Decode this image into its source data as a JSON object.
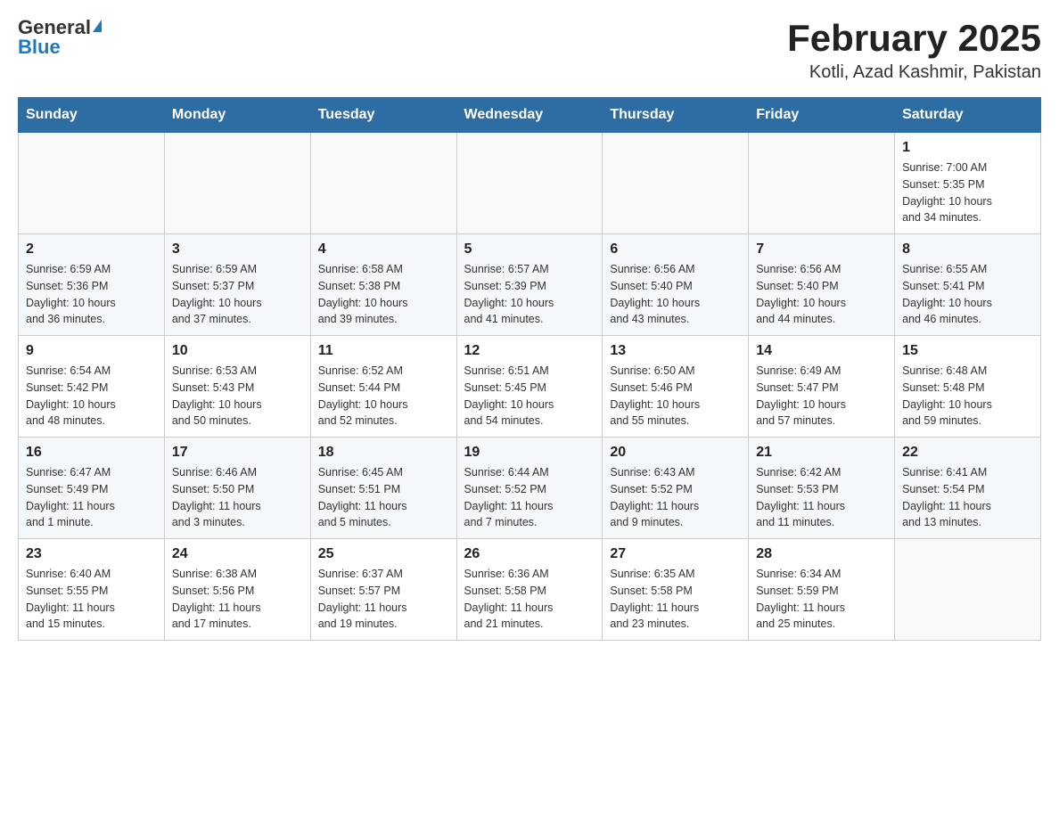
{
  "header": {
    "logo_general": "General",
    "logo_blue": "Blue",
    "month_title": "February 2025",
    "location": "Kotli, Azad Kashmir, Pakistan"
  },
  "weekdays": [
    "Sunday",
    "Monday",
    "Tuesday",
    "Wednesday",
    "Thursday",
    "Friday",
    "Saturday"
  ],
  "weeks": [
    [
      {
        "day": "",
        "info": ""
      },
      {
        "day": "",
        "info": ""
      },
      {
        "day": "",
        "info": ""
      },
      {
        "day": "",
        "info": ""
      },
      {
        "day": "",
        "info": ""
      },
      {
        "day": "",
        "info": ""
      },
      {
        "day": "1",
        "info": "Sunrise: 7:00 AM\nSunset: 5:35 PM\nDaylight: 10 hours\nand 34 minutes."
      }
    ],
    [
      {
        "day": "2",
        "info": "Sunrise: 6:59 AM\nSunset: 5:36 PM\nDaylight: 10 hours\nand 36 minutes."
      },
      {
        "day": "3",
        "info": "Sunrise: 6:59 AM\nSunset: 5:37 PM\nDaylight: 10 hours\nand 37 minutes."
      },
      {
        "day": "4",
        "info": "Sunrise: 6:58 AM\nSunset: 5:38 PM\nDaylight: 10 hours\nand 39 minutes."
      },
      {
        "day": "5",
        "info": "Sunrise: 6:57 AM\nSunset: 5:39 PM\nDaylight: 10 hours\nand 41 minutes."
      },
      {
        "day": "6",
        "info": "Sunrise: 6:56 AM\nSunset: 5:40 PM\nDaylight: 10 hours\nand 43 minutes."
      },
      {
        "day": "7",
        "info": "Sunrise: 6:56 AM\nSunset: 5:40 PM\nDaylight: 10 hours\nand 44 minutes."
      },
      {
        "day": "8",
        "info": "Sunrise: 6:55 AM\nSunset: 5:41 PM\nDaylight: 10 hours\nand 46 minutes."
      }
    ],
    [
      {
        "day": "9",
        "info": "Sunrise: 6:54 AM\nSunset: 5:42 PM\nDaylight: 10 hours\nand 48 minutes."
      },
      {
        "day": "10",
        "info": "Sunrise: 6:53 AM\nSunset: 5:43 PM\nDaylight: 10 hours\nand 50 minutes."
      },
      {
        "day": "11",
        "info": "Sunrise: 6:52 AM\nSunset: 5:44 PM\nDaylight: 10 hours\nand 52 minutes."
      },
      {
        "day": "12",
        "info": "Sunrise: 6:51 AM\nSunset: 5:45 PM\nDaylight: 10 hours\nand 54 minutes."
      },
      {
        "day": "13",
        "info": "Sunrise: 6:50 AM\nSunset: 5:46 PM\nDaylight: 10 hours\nand 55 minutes."
      },
      {
        "day": "14",
        "info": "Sunrise: 6:49 AM\nSunset: 5:47 PM\nDaylight: 10 hours\nand 57 minutes."
      },
      {
        "day": "15",
        "info": "Sunrise: 6:48 AM\nSunset: 5:48 PM\nDaylight: 10 hours\nand 59 minutes."
      }
    ],
    [
      {
        "day": "16",
        "info": "Sunrise: 6:47 AM\nSunset: 5:49 PM\nDaylight: 11 hours\nand 1 minute."
      },
      {
        "day": "17",
        "info": "Sunrise: 6:46 AM\nSunset: 5:50 PM\nDaylight: 11 hours\nand 3 minutes."
      },
      {
        "day": "18",
        "info": "Sunrise: 6:45 AM\nSunset: 5:51 PM\nDaylight: 11 hours\nand 5 minutes."
      },
      {
        "day": "19",
        "info": "Sunrise: 6:44 AM\nSunset: 5:52 PM\nDaylight: 11 hours\nand 7 minutes."
      },
      {
        "day": "20",
        "info": "Sunrise: 6:43 AM\nSunset: 5:52 PM\nDaylight: 11 hours\nand 9 minutes."
      },
      {
        "day": "21",
        "info": "Sunrise: 6:42 AM\nSunset: 5:53 PM\nDaylight: 11 hours\nand 11 minutes."
      },
      {
        "day": "22",
        "info": "Sunrise: 6:41 AM\nSunset: 5:54 PM\nDaylight: 11 hours\nand 13 minutes."
      }
    ],
    [
      {
        "day": "23",
        "info": "Sunrise: 6:40 AM\nSunset: 5:55 PM\nDaylight: 11 hours\nand 15 minutes."
      },
      {
        "day": "24",
        "info": "Sunrise: 6:38 AM\nSunset: 5:56 PM\nDaylight: 11 hours\nand 17 minutes."
      },
      {
        "day": "25",
        "info": "Sunrise: 6:37 AM\nSunset: 5:57 PM\nDaylight: 11 hours\nand 19 minutes."
      },
      {
        "day": "26",
        "info": "Sunrise: 6:36 AM\nSunset: 5:58 PM\nDaylight: 11 hours\nand 21 minutes."
      },
      {
        "day": "27",
        "info": "Sunrise: 6:35 AM\nSunset: 5:58 PM\nDaylight: 11 hours\nand 23 minutes."
      },
      {
        "day": "28",
        "info": "Sunrise: 6:34 AM\nSunset: 5:59 PM\nDaylight: 11 hours\nand 25 minutes."
      },
      {
        "day": "",
        "info": ""
      }
    ]
  ]
}
